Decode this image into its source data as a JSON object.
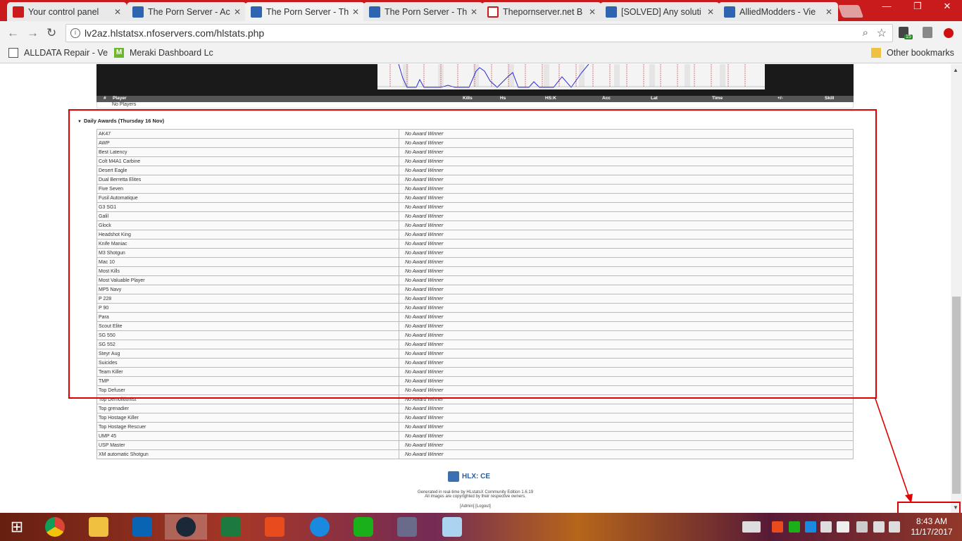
{
  "browser": {
    "tabs": [
      {
        "label": "Your control panel",
        "favicon_color": "#c91b1b"
      },
      {
        "label": "The Porn Server - Ac",
        "favicon_color": "#2e64b0"
      },
      {
        "label": "The Porn Server - Th",
        "favicon_color": "#2e64b0",
        "active": true
      },
      {
        "label": "The Porn Server - Th",
        "favicon_color": "#2e64b0"
      },
      {
        "label": "Thepornserver.net B",
        "favicon_color": "#c91b1b"
      },
      {
        "label": "[SOLVED] Any soluti",
        "favicon_color": "#2e64b0"
      },
      {
        "label": "AlliedModders - Vie",
        "favicon_color": "#2e64b0"
      }
    ],
    "url": "lv2az.hlstatsx.nfoservers.com/hlstats.php",
    "extension_badge": "15",
    "bookmarks": [
      {
        "label": "ALLDATA Repair - Ve"
      },
      {
        "label": "Meraki Dashboard Lc"
      }
    ],
    "other_bookmarks": "Other bookmarks"
  },
  "player_table": {
    "columns": [
      "#",
      "Player",
      "Kills",
      "Hs",
      "HS:K",
      "Acc",
      "Lat",
      "Time",
      "+/-",
      "Skill"
    ],
    "empty_text": "No Players"
  },
  "awards": {
    "title": "Daily Awards (Thursday 16 Nov)",
    "rows": [
      {
        "award": "AK47",
        "winner": "No Award Winner"
      },
      {
        "award": "AWP",
        "winner": "No Award Winner"
      },
      {
        "award": "Best Latency",
        "winner": "No Award Winner"
      },
      {
        "award": "Colt M4A1 Carbine",
        "winner": "No Award Winner"
      },
      {
        "award": "Desert Eagle",
        "winner": "No Award Winner"
      },
      {
        "award": "Dual Berretta Elites",
        "winner": "No Award Winner"
      },
      {
        "award": "Five Seven",
        "winner": "No Award Winner"
      },
      {
        "award": "Fusil Automatique",
        "winner": "No Award Winner"
      },
      {
        "award": "G3 SG1",
        "winner": "No Award Winner"
      },
      {
        "award": "Galil",
        "winner": "No Award Winner"
      },
      {
        "award": "Glock",
        "winner": "No Award Winner"
      },
      {
        "award": "Headshot King",
        "winner": "No Award Winner"
      },
      {
        "award": "Knife Maniac",
        "winner": "No Award Winner"
      },
      {
        "award": "M3 Shotgun",
        "winner": "No Award Winner"
      },
      {
        "award": "Mac 10",
        "winner": "No Award Winner"
      },
      {
        "award": "Most Kills",
        "winner": "No Award Winner"
      },
      {
        "award": "Most Valuable Player",
        "winner": "No Award Winner"
      },
      {
        "award": "MP5 Navy",
        "winner": "No Award Winner"
      },
      {
        "award": "P 228",
        "winner": "No Award Winner"
      },
      {
        "award": "P 90",
        "winner": "No Award Winner"
      },
      {
        "award": "Para",
        "winner": "No Award Winner"
      },
      {
        "award": "Scout Elite",
        "winner": "No Award Winner"
      },
      {
        "award": "SG 550",
        "winner": "No Award Winner"
      },
      {
        "award": "SG 552",
        "winner": "No Award Winner"
      },
      {
        "award": "Steyr Aug",
        "winner": "No Award Winner"
      },
      {
        "award": "Suicides",
        "winner": "No Award Winner"
      },
      {
        "award": "Team Killer",
        "winner": "No Award Winner"
      },
      {
        "award": "TMP",
        "winner": "No Award Winner"
      },
      {
        "award": "Top Defuser",
        "winner": "No Award Winner"
      },
      {
        "award": "Top Demolitionist",
        "winner": "No Award Winner"
      },
      {
        "award": "Top grenadier",
        "winner": "No Award Winner"
      },
      {
        "award": "Top Hostage Killer",
        "winner": "No Award Winner"
      },
      {
        "award": "Top Hostage Rescuer",
        "winner": "No Award Winner"
      },
      {
        "award": "UMP 45",
        "winner": "No Award Winner"
      },
      {
        "award": "USP Master",
        "winner": "No Award Winner"
      },
      {
        "award": "XM automatic Shotgun",
        "winner": "No Award Winner"
      }
    ]
  },
  "footer": {
    "logo_text": "HLX: CE",
    "generated": "Generated in real-time by HLstatsX Community Edition 1.6.19",
    "copyright": "All images are copyrighted by their respective owners.",
    "admin_links": "[Admin] [Logout]"
  },
  "taskbar": {
    "time": "8:43 AM",
    "date": "11/17/2017"
  },
  "colors": {
    "highlight": "#e00000",
    "chrome_tabbar": "#c91b1b",
    "header_dark": "#555555"
  }
}
